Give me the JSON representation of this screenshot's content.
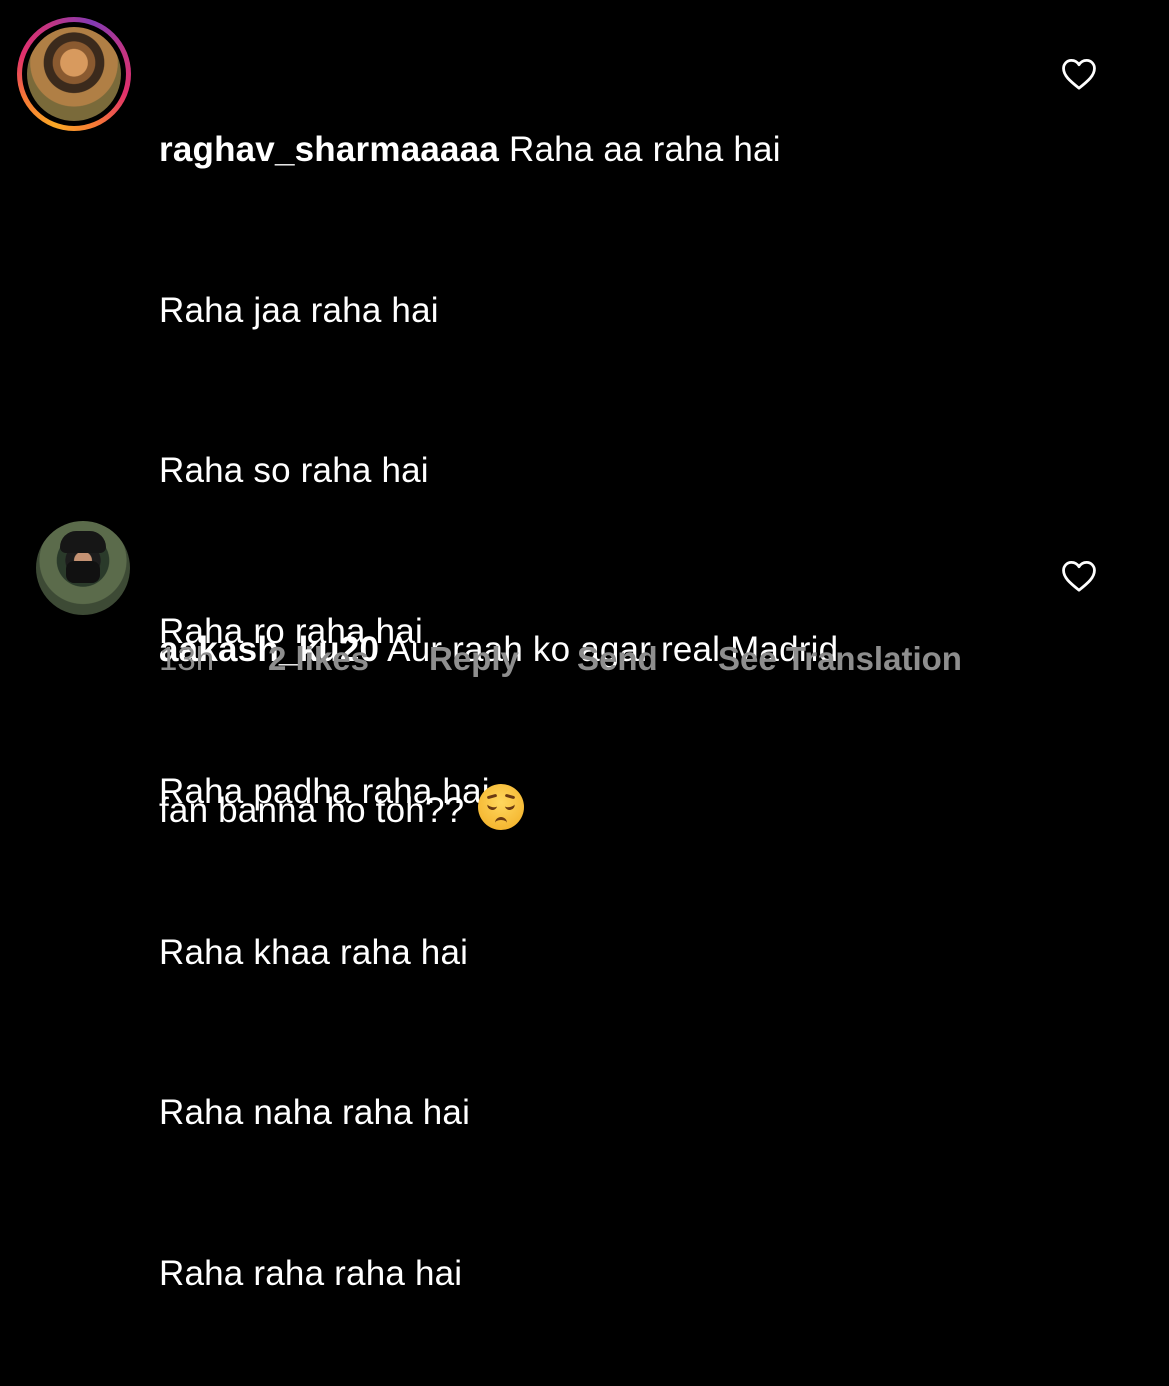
{
  "comments": [
    {
      "username": "raghav_sharmaaaaa",
      "lines": [
        "Raha aa raha hai",
        "Raha jaa raha hai",
        "Raha so raha hai",
        "Raha ro raha hai",
        "Raha padha raha hai",
        "Raha khaa raha hai",
        "Raha naha raha hai",
        "Raha raha raha hai"
      ],
      "avatar": "user-photo-avatar-with-story-ring",
      "like_icon": "heart-outline-icon"
    },
    {
      "username": "aakash_ku20",
      "lines": [
        "Aur raah ko agar real Madrid",
        "fan banna ho toh??"
      ],
      "emoji": "pensive-face-emoji",
      "avatar": "user-photo-avatar",
      "like_icon": "heart-outline-icon",
      "meta": {
        "time": "13h",
        "likes": "2 likes",
        "reply": "Reply",
        "send": "Send",
        "see_translation": "See Translation"
      }
    }
  ],
  "colors": {
    "background": "#000000",
    "text": "#ffffff",
    "meta_text": "#8e8e8e"
  }
}
